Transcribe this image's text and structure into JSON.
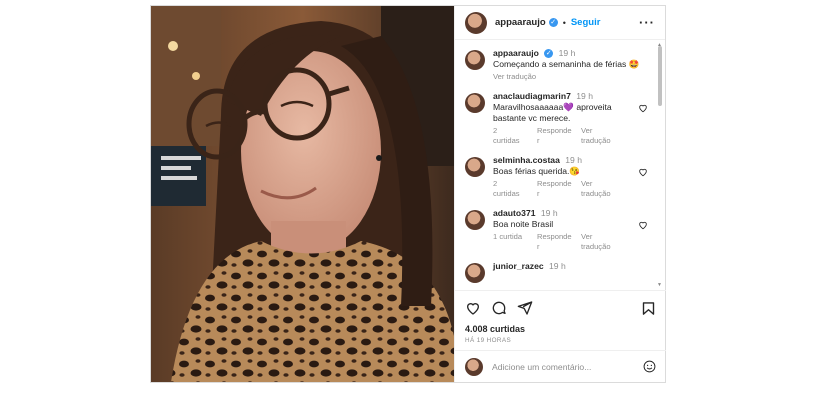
{
  "header": {
    "username": "appaaraujo",
    "separator": "•",
    "follow_label": "Seguir",
    "more_label": "···",
    "verified_mark": "✓",
    "icon": "more-options-icon"
  },
  "caption": {
    "username": "appaaraujo",
    "time": "19 h",
    "text": "Começando a semaninha de férias 🤩",
    "translate": "Ver tradução"
  },
  "comments": [
    {
      "username": "anaclaudiagmarin7",
      "time": "19 h",
      "text": "Maravilhosaaaaaa💜 aproveita bastante vc merece.",
      "likes": "2 curtidas",
      "reply": "Responde r",
      "translate": "Ver tradução"
    },
    {
      "username": "selminha.costaa",
      "time": "19 h",
      "text": "Boas férias querida.😘",
      "likes": "2 curtidas",
      "reply": "Responde r",
      "translate": "Ver tradução"
    },
    {
      "username": "adauto371",
      "time": "19 h",
      "text": "Boa noite Brasil",
      "likes": "1 curtida",
      "reply": "Responde r",
      "translate": "Ver tradução"
    },
    {
      "username": "junior_razec",
      "time": "19 h",
      "text": "",
      "likes": "",
      "reply": "",
      "translate": ""
    }
  ],
  "actions": {
    "icons": [
      "heart-icon",
      "comment-icon",
      "share-icon",
      "bookmark-icon"
    ],
    "likes": "4.008 curtidas",
    "ago": "HÁ 19 HORAS"
  },
  "add_comment": {
    "placeholder": "Adicione um comentário...",
    "icon": "emoji-icon"
  },
  "colors": {
    "accent": "#0095f6",
    "verified": "#3897f0",
    "muted": "#8e8e8e",
    "border": "#dbdbdb"
  }
}
